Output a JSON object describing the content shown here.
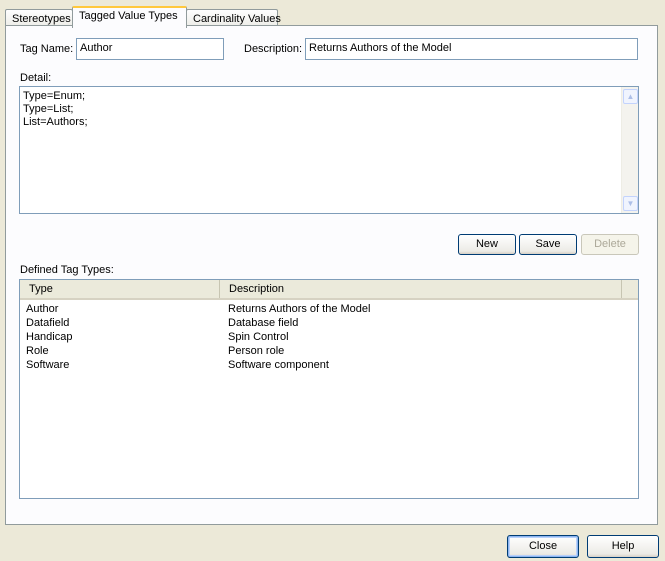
{
  "tabs": [
    "Stereotypes",
    "Tagged Value Types",
    "Cardinality Values"
  ],
  "form": {
    "tag_name_label": "Tag Name:",
    "tag_name_value": "Author",
    "description_label": "Description:",
    "description_value": "Returns Authors of the Model",
    "detail_label": "Detail:",
    "detail_lines": [
      "Type=Enum;",
      "Type=List;",
      "List=Authors;"
    ]
  },
  "actions": {
    "new": "New",
    "save": "Save",
    "delete": "Delete"
  },
  "defined": {
    "label": "Defined Tag Types:",
    "columns": [
      "Type",
      "Description"
    ],
    "rows": [
      [
        "Author",
        "Returns Authors of the Model"
      ],
      [
        "Datafield",
        "Database field"
      ],
      [
        "Handicap",
        "Spin Control"
      ],
      [
        "Role",
        "Person role"
      ],
      [
        "Software",
        "Software component"
      ]
    ]
  },
  "footer": {
    "close": "Close",
    "help": "Help"
  }
}
